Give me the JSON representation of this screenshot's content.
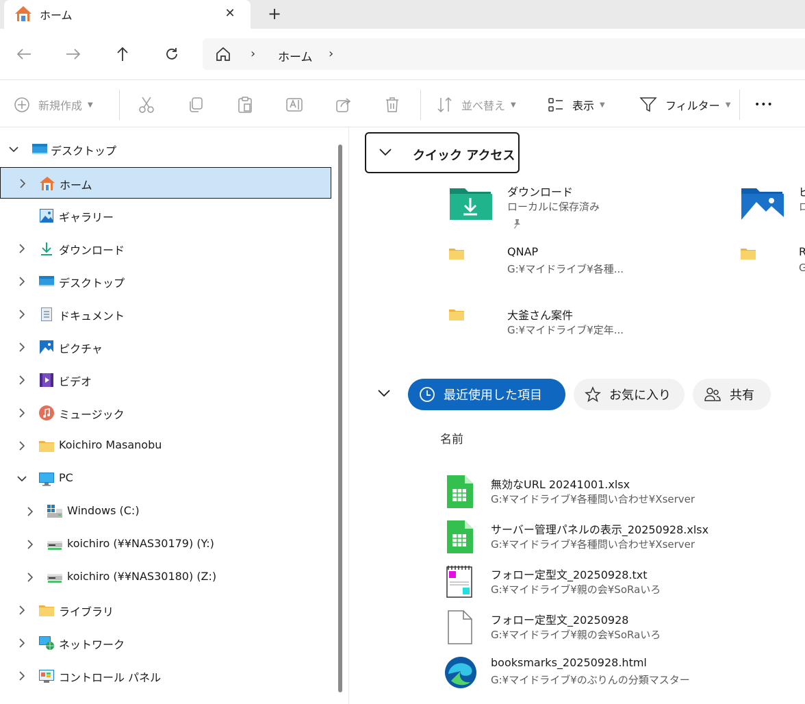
{
  "tab": {
    "title": "ホーム",
    "close": "✕",
    "new_tab": "+"
  },
  "nav": {
    "back": "←",
    "forward": "→",
    "up": "↑",
    "refresh": "↻"
  },
  "address": {
    "sep": "›",
    "crumb": "ホーム"
  },
  "toolbar": {
    "new_label": "新規作成",
    "sort_label": "並べ替え",
    "view_label": "表示",
    "filter_label": "フィルター",
    "more": "•••"
  },
  "sidebar": {
    "items": [
      {
        "label": "デスクトップ",
        "icon": "desktop-icon"
      },
      {
        "label": "ホーム",
        "icon": "home-icon"
      },
      {
        "label": "ギャラリー",
        "icon": "gallery-icon"
      },
      {
        "label": "ダウンロード",
        "icon": "download-icon"
      },
      {
        "label": "デスクトップ",
        "icon": "desktop-icon"
      },
      {
        "label": "ドキュメント",
        "icon": "document-icon"
      },
      {
        "label": "ピクチャ",
        "icon": "pictures-icon"
      },
      {
        "label": "ビデオ",
        "icon": "video-icon"
      },
      {
        "label": "ミュージック",
        "icon": "music-icon"
      },
      {
        "label": "Koichiro Masanobu",
        "icon": "folder-icon"
      },
      {
        "label": "PC",
        "icon": "pc-icon"
      },
      {
        "label": "Windows (C:)",
        "icon": "drive-icon"
      },
      {
        "label": "koichiro (¥¥NAS30179) (Y:)",
        "icon": "network-drive-icon"
      },
      {
        "label": "koichiro (¥¥NAS30180) (Z:)",
        "icon": "network-drive-icon"
      },
      {
        "label": "ライブラリ",
        "icon": "folder-icon"
      },
      {
        "label": "ネットワーク",
        "icon": "network-icon"
      },
      {
        "label": "コントロール パネル",
        "icon": "control-panel-icon"
      }
    ]
  },
  "quick_access": {
    "title": "クイック アクセス",
    "items": [
      {
        "name": "ダウンロード",
        "sub": "ローカルに保存済み",
        "icon": "download-folder-icon"
      },
      {
        "name": "ピ",
        "sub": "ロ",
        "icon": "pictures-folder-icon"
      },
      {
        "name": "QNAP",
        "sub": "G:¥マイドライブ¥各種...",
        "icon": "folder-icon"
      },
      {
        "name": "R",
        "sub": "G",
        "icon": "folder-icon"
      },
      {
        "name": "大釜さん案件",
        "sub": "G:¥マイドライブ¥定年...",
        "icon": "folder-icon"
      }
    ]
  },
  "recent": {
    "tabs": [
      {
        "label": "最近使用した項目",
        "icon": "clock-icon"
      },
      {
        "label": "お気に入り",
        "icon": "star-icon"
      },
      {
        "label": "共有",
        "icon": "people-icon"
      }
    ],
    "column_name": "名前",
    "files": [
      {
        "name": "無効なURL 20241001.xlsx",
        "path": "G:¥マイドライブ¥各種問い合わせ¥Xserver",
        "icon": "excel-file-icon"
      },
      {
        "name": "サーバー管理パネルの表示_20250928.xlsx",
        "path": "G:¥マイドライブ¥各種問い合わせ¥Xserver",
        "icon": "excel-file-icon"
      },
      {
        "name": "フォロー定型文_20250928.txt",
        "path": "G:¥マイドライブ¥親の会¥SoRaいろ",
        "icon": "notepad-file-icon"
      },
      {
        "name": "フォロー定型文_20250928",
        "path": "G:¥マイドライブ¥親の会¥SoRaいろ",
        "icon": "blank-file-icon"
      },
      {
        "name": "booksmarks_20250928.html",
        "path": "G:¥マイドライブ¥のぶりんの分類マスター",
        "icon": "edge-file-icon"
      }
    ]
  },
  "colors": {
    "accent": "#0f67c0",
    "selected_bg": "#cce4f7",
    "folder": "#f7c948"
  }
}
